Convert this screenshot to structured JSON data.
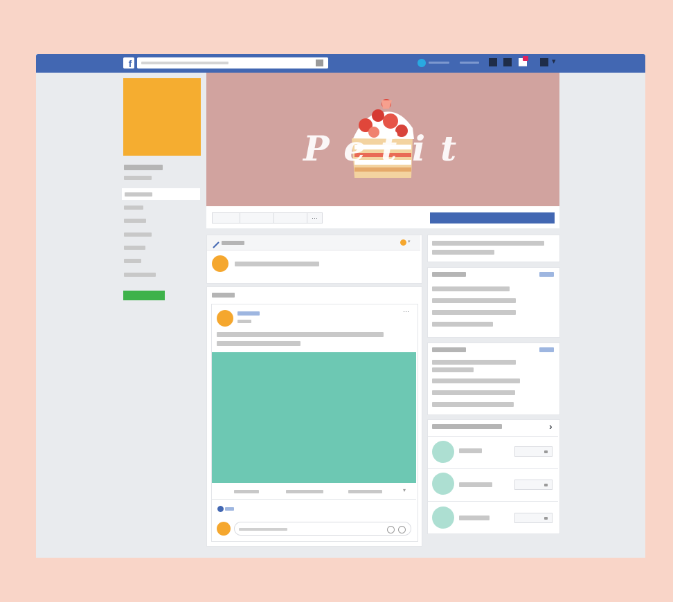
{
  "page": {
    "cover_text": "Petit",
    "more_dots": "···",
    "post_menu_dots": "···",
    "caret": "▾",
    "chevron": "›",
    "logo_glyph": "f"
  },
  "colors": {
    "backdrop": "#f9d5c8",
    "topbar": "#4267b2",
    "canvas": "#e9ebee",
    "profile_square": "#f5ad30",
    "cover": "#d1a39f",
    "cta": "#4267b2",
    "green_button": "#3eb24a",
    "post_media": "#6dc8b3",
    "avatar": "#f5a72e",
    "suggestion_avatar": "#addfd2"
  },
  "icons": {
    "logo": "facebook-logo-icon",
    "search": "search-icon",
    "pencil": "pencil-icon",
    "emoji": "emoji-icon",
    "sticker": "sticker-icon",
    "chevron": "chevron-right-icon",
    "notification": "notification-badge-icon"
  }
}
